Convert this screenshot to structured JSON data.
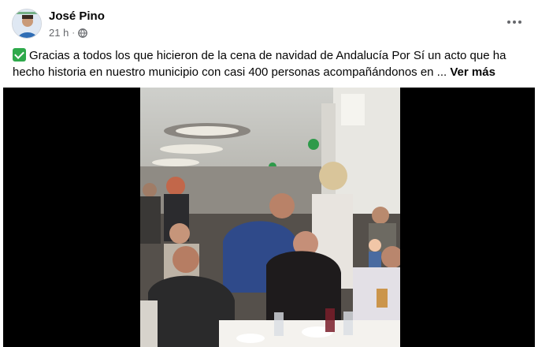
{
  "post": {
    "author": "José Pino",
    "time": "21 h",
    "separator": "·",
    "privacy_icon": "globe-icon",
    "more_icon": "ellipsis-icon",
    "check_icon": "check-mark-icon",
    "text": "Gracias a todos los que hicieron de la cena de navidad de Andalucía Por Sí un acto que ha hecho historia en nuestro municipio con casi 400 personas acompañándonos en ...",
    "see_more": "Ver más"
  },
  "colors": {
    "text_primary": "#050505",
    "text_secondary": "#65676b",
    "check_green": "#2ea94b",
    "media_background": "#000000"
  }
}
